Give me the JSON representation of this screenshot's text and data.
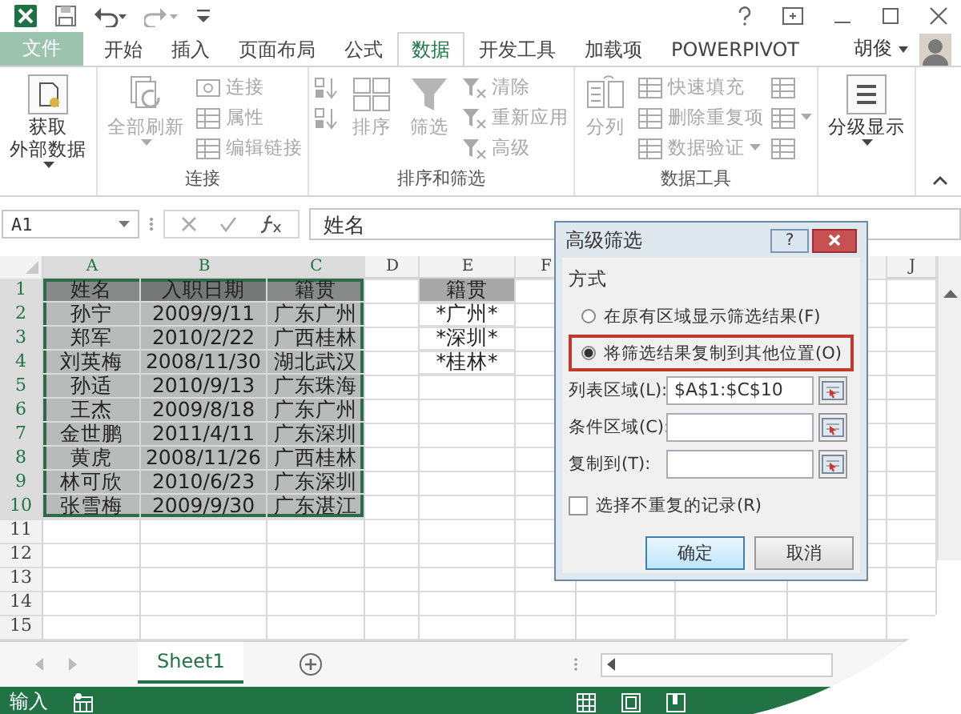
{
  "file_tab": {
    "label": "文件"
  },
  "tabs": [
    {
      "label": "开始",
      "selected": false
    },
    {
      "label": "插入",
      "selected": false
    },
    {
      "label": "页面布局",
      "selected": false
    },
    {
      "label": "公式",
      "selected": false
    },
    {
      "label": "数据",
      "selected": true
    },
    {
      "label": "开发工具",
      "selected": false
    },
    {
      "label": "加载项",
      "selected": false
    },
    {
      "label": "POWERPIVOT",
      "selected": false
    }
  ],
  "user": {
    "name": "胡俊"
  },
  "ribbon": {
    "groups": [
      {
        "items": [
          {
            "kind": "large",
            "lines": [
              "获取",
              "外部数据"
            ],
            "dropdown": true,
            "disabled": false
          }
        ]
      },
      {
        "label": "连接",
        "items": [
          {
            "kind": "large",
            "lines": [
              "全部刷新"
            ],
            "dropdown": true,
            "disabled": true
          },
          {
            "kind": "small",
            "label": "连接",
            "disabled": true
          },
          {
            "kind": "small",
            "label": "属性",
            "disabled": true
          },
          {
            "kind": "small",
            "label": "编辑链接",
            "disabled": true
          }
        ]
      },
      {
        "label": "排序和筛选",
        "items": [
          {
            "kind": "icon",
            "disabled": true
          },
          {
            "kind": "icon",
            "disabled": true
          },
          {
            "kind": "large",
            "lines": [
              "排序"
            ],
            "dropdown": false,
            "disabled": true
          },
          {
            "kind": "large",
            "lines": [
              "筛选"
            ],
            "dropdown": false,
            "disabled": true
          },
          {
            "kind": "small",
            "label": "清除",
            "disabled": true
          },
          {
            "kind": "small",
            "label": "重新应用",
            "disabled": true
          },
          {
            "kind": "small",
            "label": "高级",
            "disabled": true
          }
        ]
      },
      {
        "label": "数据工具",
        "items": [
          {
            "kind": "large",
            "lines": [
              "分列"
            ],
            "dropdown": false,
            "disabled": true
          },
          {
            "kind": "small",
            "label": "快速填充",
            "disabled": true
          },
          {
            "kind": "small",
            "label": "删除重复项",
            "disabled": true
          },
          {
            "kind": "small",
            "label": "数据验证",
            "dropdown": true,
            "disabled": true
          },
          {
            "kind": "icon",
            "disabled": true
          },
          {
            "kind": "icon",
            "dropdown": true,
            "disabled": true
          },
          {
            "kind": "icon",
            "disabled": true
          }
        ]
      },
      {
        "items": [
          {
            "kind": "large",
            "lines": [
              "分级显示"
            ],
            "dropdown": true,
            "disabled": false
          }
        ]
      }
    ]
  },
  "formula_bar": {
    "name_box": "A1",
    "formula": "姓名"
  },
  "sheet": {
    "columns": [
      "A",
      "B",
      "C",
      "D",
      "E",
      "F",
      "J"
    ],
    "rows": [
      {
        "number": "1",
        "A": {
          "text": "姓名",
          "color": "#8f8f8f",
          "selected": true
        },
        "B": {
          "text": "入职日期",
          "color": "#7c7c7c",
          "selected": true
        },
        "C": {
          "text": "籍贯",
          "color": "#8f8f8f",
          "selected": true
        },
        "E": {
          "text": "籍贯",
          "color": "#a8a8a8",
          "selected": false
        }
      },
      {
        "number": "2",
        "A": {
          "text": "孙宁",
          "color": "#c4c4c4",
          "selected": true
        },
        "B": {
          "text": "2009/9/11",
          "color": "#c4c4c4",
          "selected": true
        },
        "C": {
          "text": "广东广州",
          "color": "#c4c4c4",
          "selected": true
        },
        "E": {
          "text": "*广州*",
          "selected": false
        }
      },
      {
        "number": "3",
        "A": {
          "text": "郑军",
          "color": "#c4c4c4",
          "selected": true
        },
        "B": {
          "text": "2010/2/22",
          "color": "#c4c4c4",
          "selected": true
        },
        "C": {
          "text": "广西桂林",
          "color": "#c4c4c4",
          "selected": true
        },
        "E": {
          "text": "*深圳*",
          "selected": false
        }
      },
      {
        "number": "4",
        "A": {
          "text": "刘英梅",
          "color": "#c4c4c4",
          "selected": true
        },
        "B": {
          "text": "2008/11/30",
          "color": "#c4c4c4",
          "selected": true
        },
        "C": {
          "text": "湖北武汉",
          "color": "#c4c4c4",
          "selected": true
        },
        "E": {
          "text": "*桂林*",
          "selected": false
        }
      },
      {
        "number": "5",
        "A": {
          "text": "孙适",
          "color": "#c4c4c4",
          "selected": true
        },
        "B": {
          "text": "2010/9/13",
          "color": "#c4c4c4",
          "selected": true
        },
        "C": {
          "text": "广东珠海",
          "color": "#c4c4c4",
          "selected": true
        }
      },
      {
        "number": "6",
        "A": {
          "text": "王杰",
          "color": "#c4c4c4",
          "selected": true
        },
        "B": {
          "text": "2009/8/18",
          "color": "#c4c4c4",
          "selected": true
        },
        "C": {
          "text": "广东广州",
          "color": "#c4c4c4",
          "selected": true
        }
      },
      {
        "number": "7",
        "A": {
          "text": "金世鹏",
          "color": "#c4c4c4",
          "selected": true
        },
        "B": {
          "text": "2011/4/11",
          "color": "#c4c4c4",
          "selected": true
        },
        "C": {
          "text": "广东深圳",
          "color": "#c4c4c4",
          "selected": true
        }
      },
      {
        "number": "8",
        "A": {
          "text": "黄虎",
          "color": "#c4c4c4",
          "selected": true
        },
        "B": {
          "text": "2008/11/26",
          "color": "#c4c4c4",
          "selected": true
        },
        "C": {
          "text": "广西桂林",
          "color": "#c4c4c4",
          "selected": true
        }
      },
      {
        "number": "9",
        "A": {
          "text": "林可欣",
          "color": "#c4c4c4",
          "selected": true
        },
        "B": {
          "text": "2010/6/23",
          "color": "#c4c4c4",
          "selected": true
        },
        "C": {
          "text": "广东深圳",
          "color": "#c4c4c4",
          "selected": true
        }
      },
      {
        "number": "10",
        "A": {
          "text": "张雪梅",
          "color": "#c4c4c4",
          "selected": true
        },
        "B": {
          "text": "2009/9/30",
          "color": "#c4c4c4",
          "selected": true
        },
        "C": {
          "text": "广东湛江",
          "color": "#c4c4c4",
          "selected": true
        }
      },
      {
        "number": "11"
      },
      {
        "number": "12"
      },
      {
        "number": "13"
      },
      {
        "number": "14"
      },
      {
        "number": "15"
      }
    ]
  },
  "dialog": {
    "title": "高级筛选",
    "help": "?",
    "section": "方式",
    "modes": [
      {
        "label": "在原有区域显示筛选结果(F)",
        "selected": false,
        "highlighted": false
      },
      {
        "label": "将筛选结果复制到其他位置(O)",
        "selected": true,
        "highlighted": true
      }
    ],
    "fields": [
      {
        "label": "列表区域(L):",
        "value": "$A$1:$C$10"
      },
      {
        "label": "条件区域(C):"
      },
      {
        "label": "复制到(T):"
      }
    ],
    "unique_only": {
      "label": "选择不重复的记录(R)",
      "checked": false
    },
    "buttons": [
      {
        "label": "确定",
        "default": true
      },
      {
        "label": "取消",
        "default": false
      }
    ]
  },
  "sheet_tabs": [
    {
      "label": "Sheet1",
      "selected": true
    }
  ],
  "status_bar": {
    "mode": "输入"
  }
}
